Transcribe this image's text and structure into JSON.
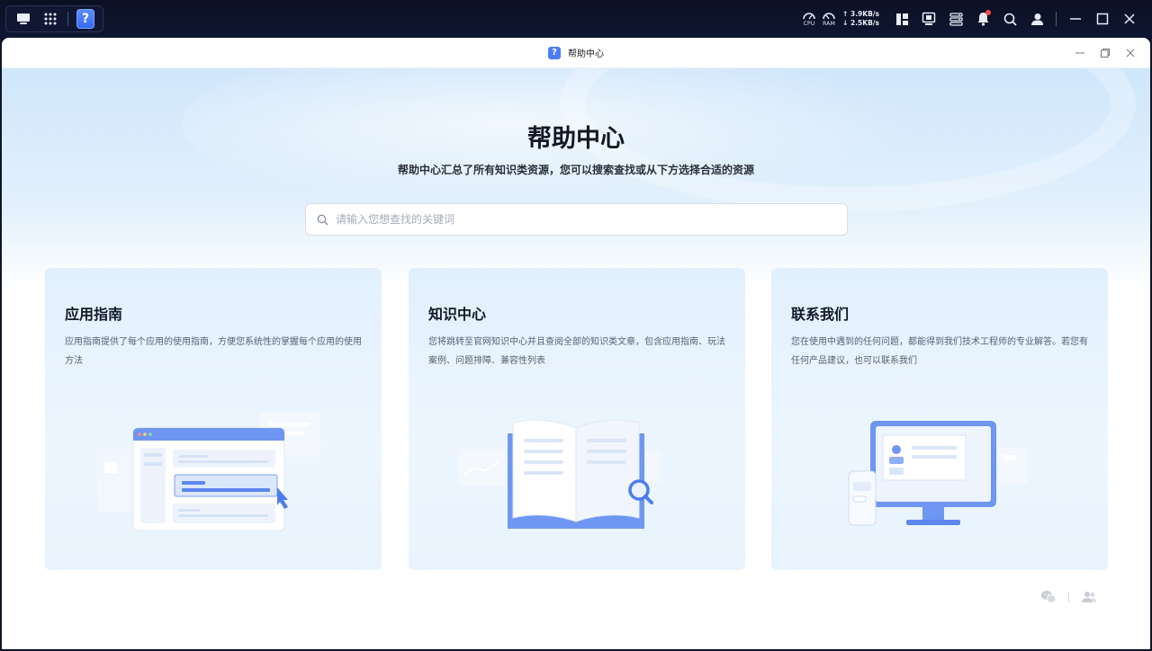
{
  "taskbar": {
    "cpu_label": "CPU",
    "ram_label": "RAM",
    "upload": "↑ 3.9KB/s",
    "download": "↓ 2.5KB/s",
    "icons": [
      "desktop-icon",
      "app-grid-icon",
      "help-app-icon",
      "cpu-gauge-icon",
      "ram-gauge-icon",
      "widgets-icon",
      "monitor-icon",
      "task-manager-icon",
      "notification-bell-icon",
      "search-icon",
      "user-icon",
      "minimize-icon",
      "maximize-icon",
      "close-icon"
    ],
    "app_icon_glyph": "?"
  },
  "window": {
    "title": "帮助中心",
    "title_icon_glyph": "?"
  },
  "hero": {
    "title": "帮助中心",
    "subtitle": "帮助中心汇总了所有知识类资源，您可以搜索查找或从下方选择合适的资源"
  },
  "search": {
    "placeholder": "请输入您想查找的关键词",
    "value": ""
  },
  "cards": [
    {
      "title": "应用指南",
      "description": "应用指南提供了每个应用的使用指南，方便您系统性的掌握每个应用的使用方法"
    },
    {
      "title": "知识中心",
      "description": "您将跳转至官网知识中心并且查阅全部的知识类文章，包含应用指南、玩法案例、问题排障、兼容性列表"
    },
    {
      "title": "联系我们",
      "description": "您在使用中遇到的任何问题，都能得到我们技术工程师的专业解答。若您有任何产品建议，也可以联系我们"
    }
  ],
  "footer": {
    "icons": [
      "wechat-icon",
      "community-icon"
    ]
  },
  "colors": {
    "accent": "#4a7cf6",
    "taskbar_bg": "#0b1024",
    "card_bg": "#e2f0fd"
  }
}
